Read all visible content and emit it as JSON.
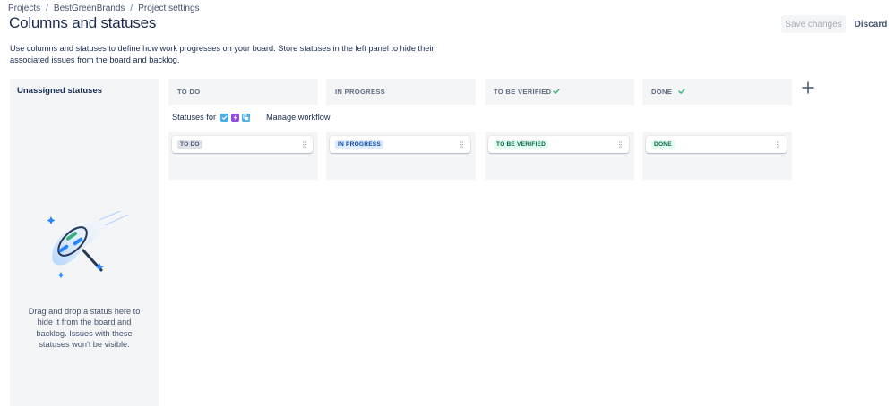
{
  "breadcrumb": {
    "items": [
      "Projects",
      "BestGreenBrands",
      "Project settings"
    ],
    "separator": "/"
  },
  "page": {
    "title": "Columns and statuses",
    "description": "Use columns and statuses to define how work progresses on your board. Store statuses in the left panel to hide their associated issues from the board and backlog."
  },
  "actions": {
    "save_label": "Save changes",
    "discard_label": "Discard"
  },
  "unassigned": {
    "title": "Unassigned statuses",
    "hint": "Drag and drop a status here to hide it from the board and backlog. Issues with these statuses won't be visible."
  },
  "statuses_for": {
    "label": "Statuses for",
    "issue_types": [
      {
        "icon": "task-icon",
        "color": "#4bade8"
      },
      {
        "icon": "epic-icon",
        "color": "#904ee2"
      },
      {
        "icon": "subtask-icon",
        "color": "#4bade8"
      }
    ],
    "manage_workflow_label": "Manage workflow"
  },
  "columns": [
    {
      "header": "TO DO",
      "checked": false,
      "status": {
        "label": "TO DO",
        "bg": "#dfe1e6",
        "fg": "#42526e"
      }
    },
    {
      "header": "IN PROGRESS",
      "checked": false,
      "status": {
        "label": "IN PROGRESS",
        "bg": "#deebff",
        "fg": "#0747a6"
      }
    },
    {
      "header": "TO BE VERIFIED",
      "checked": true,
      "status": {
        "label": "TO BE VERIFIED",
        "bg": "#e3fcef",
        "fg": "#006644"
      }
    },
    {
      "header": "DONE",
      "checked": true,
      "status": {
        "label": "DONE",
        "bg": "#e3fcef",
        "fg": "#006644"
      }
    }
  ],
  "colors": {
    "panel_bg": "#f4f5f7",
    "text": "#172b4d",
    "check": "#36b37e"
  }
}
